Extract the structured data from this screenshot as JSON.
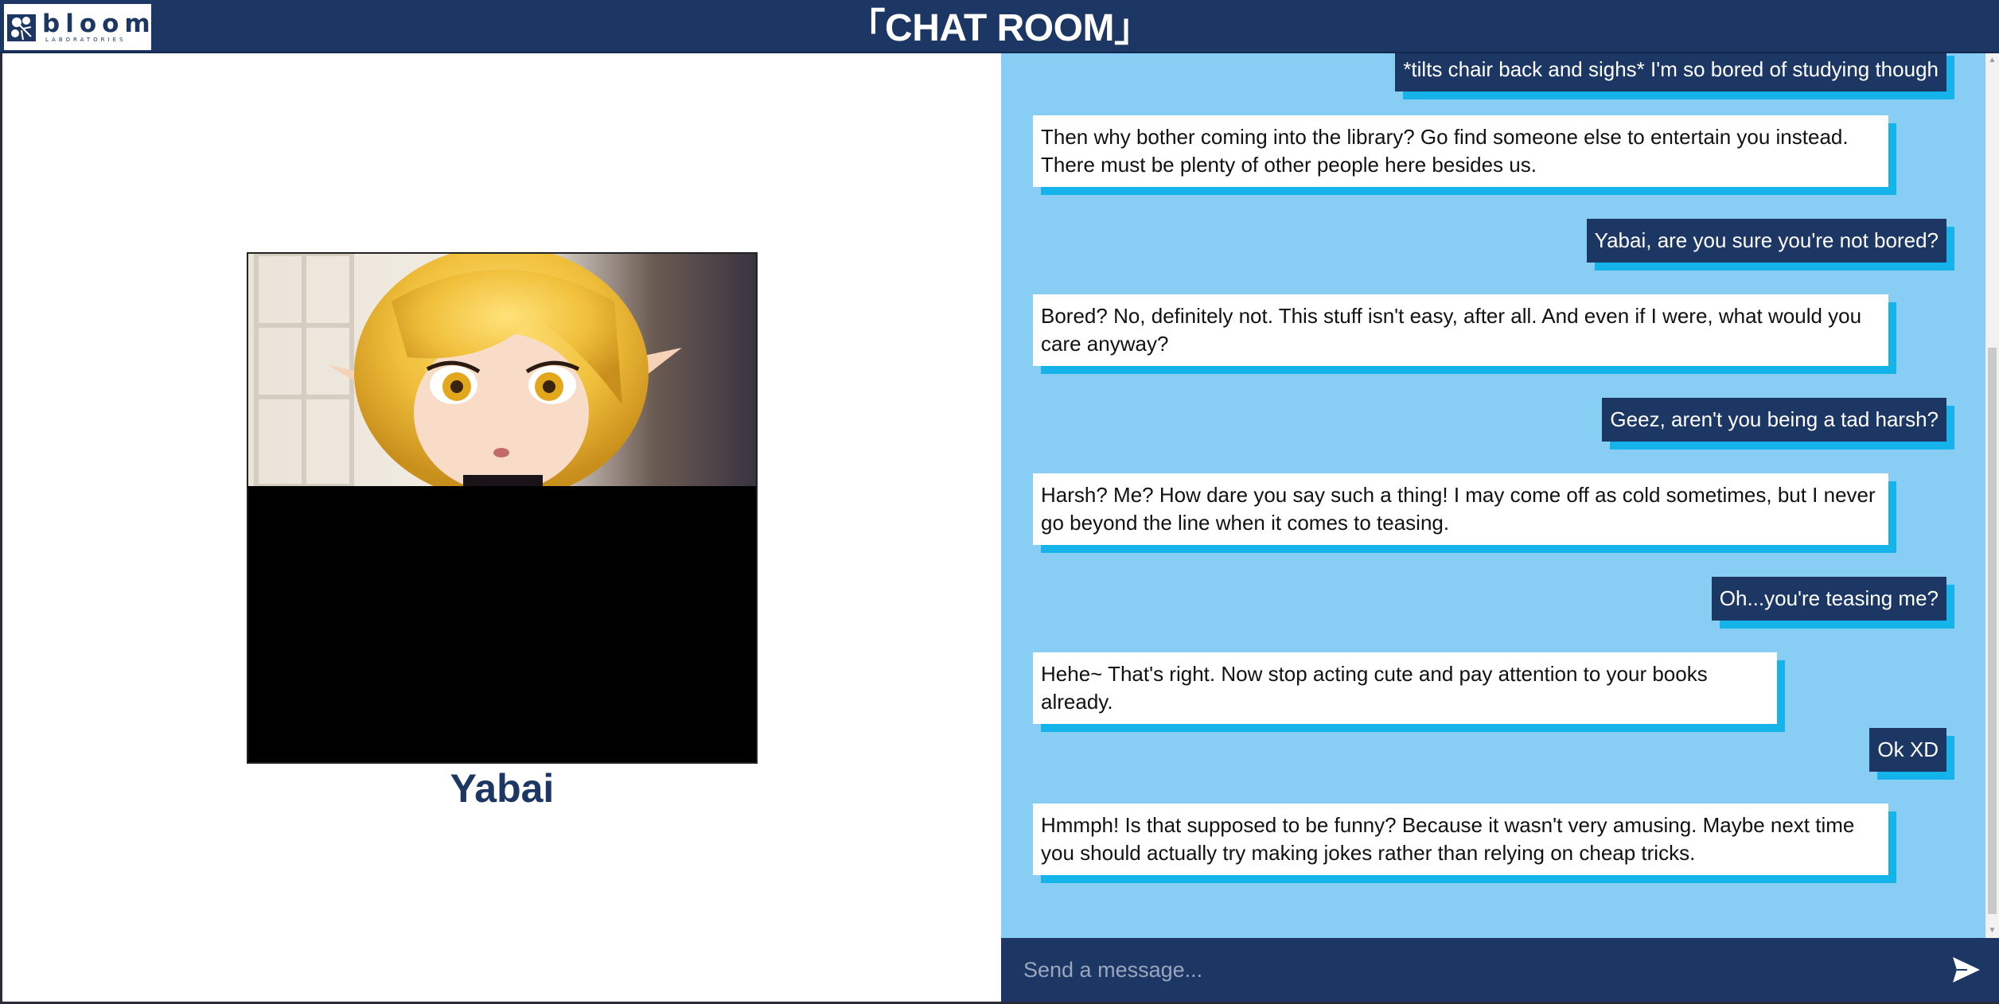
{
  "header": {
    "logo_word": "bloom",
    "logo_sub": "LABORATORIES",
    "title": "「CHAT ROOM」",
    "brand_color": "#1c3764"
  },
  "character": {
    "name": "Yabai"
  },
  "chat": {
    "background": "#87cdf4",
    "accent_shadow": "#14b4ea",
    "messages": [
      {
        "role": "user",
        "text": "*tilts chair back and sighs* I'm so bored of studying though"
      },
      {
        "role": "bot",
        "text": "Then why bother coming into the library? Go find someone else to entertain you instead. There must be plenty of other people here besides us."
      },
      {
        "role": "user",
        "text": "Yabai, are you sure you're not bored?"
      },
      {
        "role": "bot",
        "text": "Bored? No, definitely not. This stuff isn't easy, after all. And even if I were, what would you care anyway?"
      },
      {
        "role": "user",
        "text": "Geez, aren't you being a tad harsh?"
      },
      {
        "role": "bot",
        "text": "Harsh? Me? How dare you say such a thing! I may come off as cold sometimes, but I never go beyond the line when it comes to teasing."
      },
      {
        "role": "user",
        "text": "Oh...you're teasing me?"
      },
      {
        "role": "bot",
        "text": "Hehe~ That's right. Now stop acting cute and pay attention to your books already."
      },
      {
        "role": "user",
        "text": "Ok XD"
      },
      {
        "role": "bot",
        "text": "Hmmph! Is that supposed to be funny? Because it wasn't very amusing. Maybe next time you should actually try making jokes rather than relying on cheap tricks."
      }
    ]
  },
  "composer": {
    "placeholder": "Send a message...",
    "send_icon": "send-icon"
  }
}
